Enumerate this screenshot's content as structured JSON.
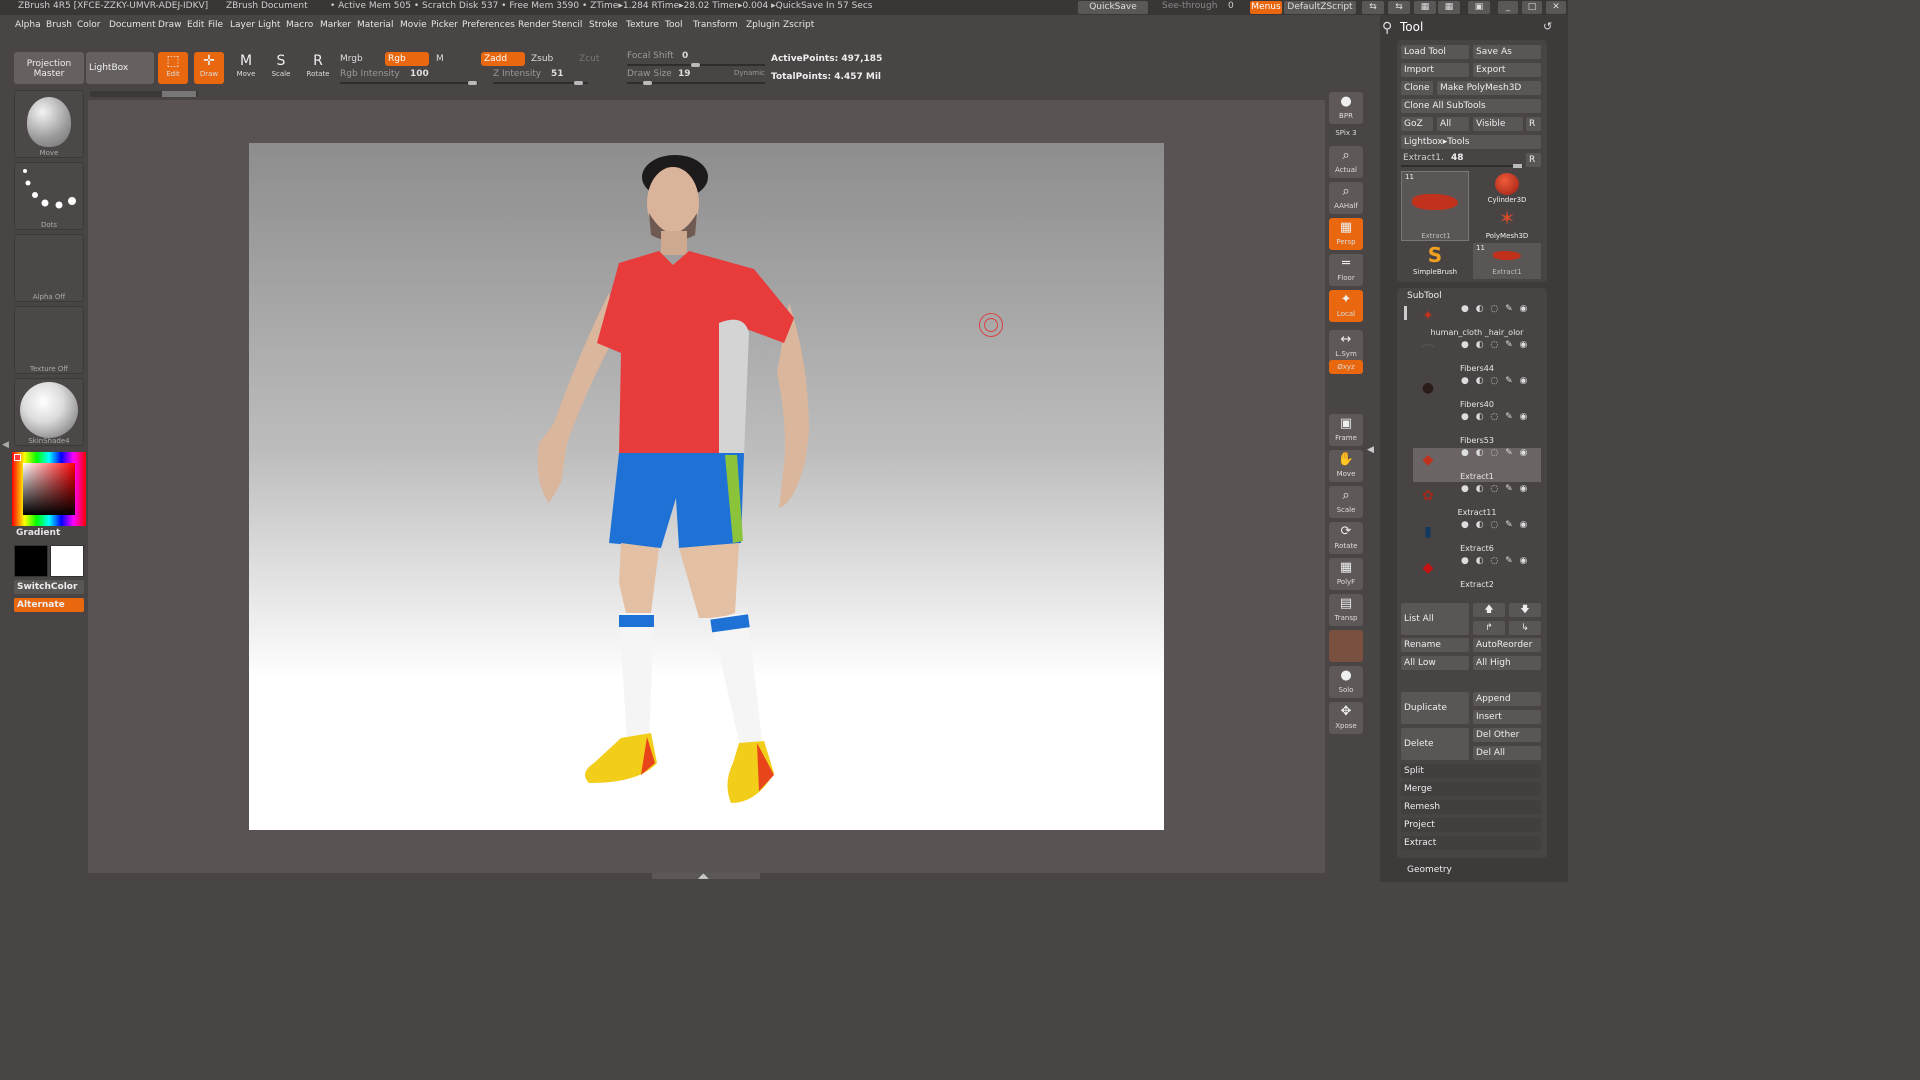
{
  "titlebar": {
    "app": "ZBrush 4R5 [XFCE-ZZKY-UMVR-ADEJ-IDKV]",
    "doc": "ZBrush Document",
    "status": "• Active Mem 505 • Scratch Disk 537 • Free Mem 3590 • ZTime▸1.284 RTime▸28.02 Timer▸0.004 ▸QuickSave In 57 Secs",
    "quicksave": "QuickSave",
    "seethrough": "See-through",
    "seethrough_value": "0",
    "menus": "Menus",
    "script": "DefaultZScript"
  },
  "menubar": [
    "Alpha",
    "Brush",
    "Color",
    "Document",
    "Draw",
    "Edit",
    "File",
    "Layer",
    "Light",
    "Macro",
    "Marker",
    "Material",
    "Movie",
    "Picker",
    "Preferences",
    "Render",
    "Stencil",
    "Stroke",
    "Texture",
    "Tool",
    "Transform",
    "Zplugin",
    "Zscript"
  ],
  "toolbar": {
    "projection_master": "Projection Master",
    "lightbox": "LightBox",
    "edit": "Edit",
    "draw": "Draw",
    "move": "Move",
    "scale": "Scale",
    "rotate": "Rotate",
    "mrgb": "Mrgb",
    "rgb": "Rgb",
    "m": "M",
    "zadd": "Zadd",
    "zsub": "Zsub",
    "zcut": "Zcut",
    "rgb_intensity_label": "Rgb Intensity",
    "rgb_intensity": "100",
    "z_intensity_label": "Z Intensity",
    "z_intensity": "51",
    "focal_shift_label": "Focal Shift",
    "focal_shift": "0",
    "draw_size_label": "Draw Size",
    "draw_size": "19",
    "dynamic": "Dynamic",
    "active_points_label": "ActivePoints:",
    "active_points": "497,185",
    "total_points_label": "TotalPoints:",
    "total_points": "4.457 Mil"
  },
  "leftshelf": {
    "move": "Move",
    "dots": "Dots",
    "alpha": "Alpha  Off",
    "texture": "Texture  Off",
    "material": "SkinShade4",
    "gradient": "Gradient",
    "switchcolor": "SwitchColor",
    "alternate": "Alternate"
  },
  "rightshelf": [
    {
      "name": "bpr",
      "label": "BPR",
      "glyph": "●"
    },
    {
      "name": "spix",
      "label": "SPix 3",
      "glyph": ""
    },
    {
      "name": "actual",
      "label": "Actual",
      "glyph": "⌕"
    },
    {
      "name": "aahalf",
      "label": "AAHalf",
      "glyph": "⌕"
    },
    {
      "name": "persp",
      "label": "Persp",
      "glyph": "▦"
    },
    {
      "name": "floor",
      "label": "Floor",
      "glyph": "═"
    },
    {
      "name": "local",
      "label": "Local",
      "glyph": "✦"
    },
    {
      "name": "lsym",
      "label": "L.Sym",
      "glyph": "↔"
    },
    {
      "name": "xyz",
      "label": "Øxyz",
      "glyph": ""
    },
    {
      "name": "frame",
      "label": "Frame",
      "glyph": "▣"
    },
    {
      "name": "move",
      "label": "Move",
      "glyph": "✋"
    },
    {
      "name": "scale",
      "label": "Scale",
      "glyph": "⌕"
    },
    {
      "name": "rotate",
      "label": "Rotate",
      "glyph": "⟳"
    },
    {
      "name": "polyf",
      "label": "PolyF",
      "glyph": "▦"
    },
    {
      "name": "transp",
      "label": "Transp",
      "glyph": "▤"
    },
    {
      "name": "solo",
      "label": "Solo",
      "glyph": "●"
    },
    {
      "name": "xpose",
      "label": "Xpose",
      "glyph": "✥"
    }
  ],
  "toolpanel": {
    "title": "Tool",
    "load_tool": "Load Tool",
    "save_as": "Save As",
    "import": "Import",
    "export": "Export",
    "clone": "Clone",
    "make_polymesh": "Make PolyMesh3D",
    "clone_all": "Clone All SubTools",
    "goz": "GoZ",
    "all": "All",
    "visible": "Visible",
    "r": "R",
    "lightbox_tools": "Lightbox▸Tools",
    "extract_label": "Extract1.",
    "extract_value": "48",
    "thumbs": [
      "Extract1",
      "Cylinder3D",
      "PolyMesh3D",
      "SimpleBrush",
      "Extract1"
    ],
    "thumb_counts": [
      "11",
      "11"
    ],
    "subtool_title": "SubTool",
    "subtools": [
      "human_cloth _hair_olor",
      "Fibers44",
      "Fibers40",
      "Fibers53",
      "Extract1",
      "Extract11",
      "Extract6",
      "Extract2"
    ],
    "list_all": "List All",
    "rename": "Rename",
    "autoreorder": "AutoReorder",
    "all_low": "All Low",
    "all_high": "All High",
    "duplicate": "Duplicate",
    "append": "Append",
    "insert": "Insert",
    "delete": "Delete",
    "del_other": "Del Other",
    "del_all": "Del All",
    "split": "Split",
    "merge": "Merge",
    "remesh": "Remesh",
    "project": "Project",
    "extract": "Extract",
    "geometry": "Geometry"
  },
  "colors": {
    "accent": "#e8670f",
    "panel": "#3e3a3a",
    "background": "#4a4545"
  }
}
